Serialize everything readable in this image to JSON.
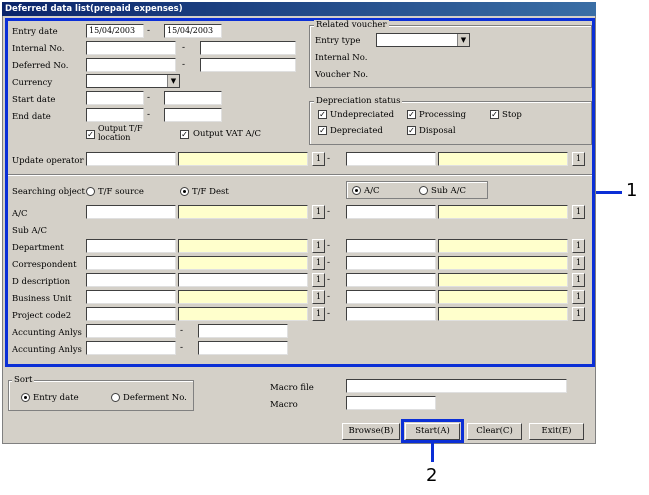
{
  "window": {
    "title": "Deferred data list(prepaid expenses)"
  },
  "filters": {
    "entry_date": {
      "label": "Entry date",
      "from": "15/04/2003",
      "to": "15/04/2003",
      "sep": "-"
    },
    "internal_no": {
      "label": "Internal No.",
      "from": "",
      "to": "",
      "sep": "-"
    },
    "deferred_no": {
      "label": "Deferred No.",
      "from": "",
      "to": "",
      "sep": "-"
    },
    "currency": {
      "label": "Currency",
      "value": ""
    },
    "start_date": {
      "label": "Start date",
      "sep": "-"
    },
    "end_date": {
      "label": "End date",
      "sep": "-"
    },
    "output_tf_location": {
      "label": "Output T/F location",
      "checked": true
    },
    "output_vat_ac": {
      "label": "Output VAT A/C",
      "checked": true
    },
    "update_operator": {
      "label": "Update operator",
      "btn": "1",
      "sep": "-"
    }
  },
  "related_voucher": {
    "title": "Related voucher",
    "entry_type_label": "Entry type",
    "entry_type_value": "",
    "internal_no_label": "Internal No.",
    "voucher_no_label": "Voucher No."
  },
  "depreciation_status": {
    "title": "Depreciation status",
    "options": [
      {
        "label": "Undepreciated",
        "checked": true
      },
      {
        "label": "Processing",
        "checked": true
      },
      {
        "label": "Stop",
        "checked": true
      },
      {
        "label": "Depreciated",
        "checked": true
      },
      {
        "label": "Disposal",
        "checked": true
      }
    ]
  },
  "searching_object": {
    "label": "Searching object",
    "tf_source": "T/F source",
    "tf_dest": "T/F Dest",
    "selected": "T/F Dest",
    "ac": "A/C",
    "sub_ac": "Sub A/C",
    "ac_selected": "A/C"
  },
  "search_rows": [
    {
      "label": "A/C",
      "btn": "1"
    },
    {
      "label": "Sub A/C"
    },
    {
      "label": "Department",
      "btn": "1"
    },
    {
      "label": "Correspondent",
      "btn": "1"
    },
    {
      "label": "D description",
      "btn": "1"
    },
    {
      "label": "Business Unit",
      "btn": "1"
    },
    {
      "label": "Project code2",
      "btn": "1"
    },
    {
      "label": "Accunting Anlys"
    },
    {
      "label": "Accunting Anlys"
    }
  ],
  "sort": {
    "title": "Sort",
    "entry_date": "Entry date",
    "deferment_no": "Deferment No.",
    "selected": "Entry date"
  },
  "macro": {
    "file_label": "Macro file",
    "macro_label": "Macro"
  },
  "buttons": {
    "browse": "Browse(B)",
    "start": "Start(A)",
    "clear": "Clear(C)",
    "exit": "Exit(E)"
  },
  "callouts": {
    "one": "1",
    "two": "2"
  },
  "colors": {
    "highlight": "#0b2fd6",
    "title_bar": "#0a246a",
    "yellow_field": "#ffffcc"
  }
}
